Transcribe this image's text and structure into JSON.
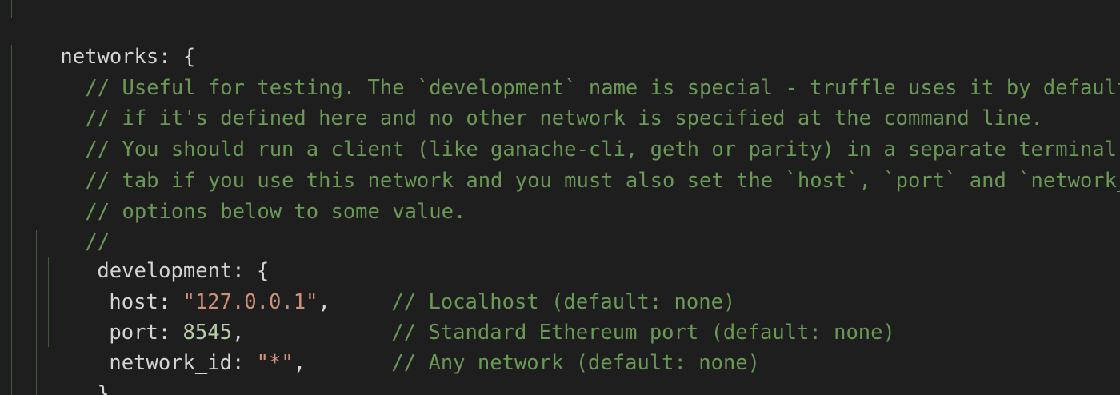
{
  "editor": {
    "lines": [
      {
        "code": "networks: {",
        "comment": ""
      },
      {
        "code": "",
        "comment": "// Useful for testing. The `development` name is special - truffle uses it by default"
      },
      {
        "code": "",
        "comment": "// if it's defined here and no other network is specified at the command line."
      },
      {
        "code": "",
        "comment": "// You should run a client (like ganache-cli, geth or parity) in a separate terminal"
      },
      {
        "code": "",
        "comment": "// tab if you use this network and you must also set the `host`, `port` and `network_id`"
      },
      {
        "code": "",
        "comment": "// options below to some value."
      },
      {
        "code": "",
        "comment": "//"
      },
      {
        "code": "development: {",
        "comment": ""
      },
      {
        "key": "host: ",
        "value": "\"127.0.0.1\"",
        "tail": ",",
        "comment": "// Localhost (default: none)"
      },
      {
        "key": "port: ",
        "value": "8545",
        "tail": ",",
        "comment": "// Standard Ethereum port (default: none)"
      },
      {
        "key": "network_id: ",
        "value": "\"*\"",
        "tail": ",",
        "comment": "// Any network (default: none)"
      },
      {
        "code": "},",
        "comment": ""
      }
    ]
  },
  "colors": {
    "background": "#1e1e1e",
    "text": "#d4d4d4",
    "comment": "#6a9955",
    "string": "#ce9178",
    "number": "#b5cea8",
    "indent_guide": "#3f5a39"
  }
}
